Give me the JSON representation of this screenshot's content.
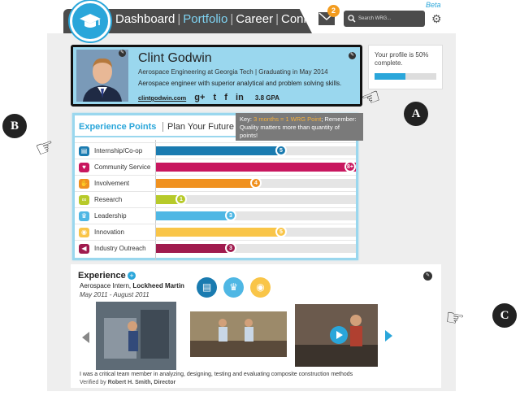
{
  "nav": {
    "items": [
      {
        "label": "Dashboard",
        "active": false
      },
      {
        "label": "Portfolio",
        "active": true
      },
      {
        "label": "Career",
        "active": false
      },
      {
        "label": "Connect",
        "active": false
      }
    ],
    "beta": "Beta",
    "mail_count": "2",
    "search_placeholder": "Search WRG...",
    "icons": [
      "graduation-cap-icon",
      "mail-icon",
      "search-icon",
      "gear-icon"
    ]
  },
  "profile": {
    "name": "Clint Godwin",
    "subtitle": "Aerospace Engineering at Georgia Tech | Graduating in May 2014",
    "description": "Aerospace engineer with superior analytical and problem solving skills.",
    "website": "clintgodwin.com",
    "social": [
      "g+",
      "t",
      "f",
      "in"
    ],
    "gpa": "3.8 GPA"
  },
  "completion": {
    "text": "Your profile is 50% complete.",
    "percent": 50
  },
  "points": {
    "tabs": [
      "Experience Points",
      "Plan Your Future"
    ],
    "key_prefix": "Key: ",
    "key_highlight": "3 months = 1 WRG Point",
    "key_rest": "; Remember: Quality matters more than quantity of points!",
    "max": 8,
    "rows": [
      {
        "label": "Internship/Co-op",
        "value": 5,
        "display": "5",
        "color": "#1a7bb0",
        "icon": "briefcase-icon"
      },
      {
        "label": "Community Service",
        "value": 8,
        "display": "8+",
        "color": "#c8175f",
        "icon": "heart-icon"
      },
      {
        "label": "Involvement",
        "value": 4,
        "display": "4",
        "color": "#f0911f",
        "icon": "hand-icon"
      },
      {
        "label": "Research",
        "value": 1,
        "display": "1",
        "color": "#b7ca2a",
        "icon": "infinity-icon"
      },
      {
        "label": "Leadership",
        "value": 3,
        "display": "3",
        "color": "#4fb7e4",
        "icon": "crown-icon"
      },
      {
        "label": "Innovation",
        "value": 5,
        "display": "5",
        "color": "#f9c548",
        "icon": "eye-icon"
      },
      {
        "label": "Industry Outreach",
        "value": 3,
        "display": "3",
        "color": "#a01b4e",
        "icon": "megaphone-icon"
      }
    ]
  },
  "callouts": {
    "a": "A",
    "b": "B",
    "c": "C"
  },
  "experience": {
    "title": "Experience",
    "role_prefix": "Aerospace Intern, ",
    "company": "Lockheed Martin",
    "dates": "May 2011 - August 2011",
    "description": "I was a critical team member in analyzing, designing, testing and evaluating composite construction methods",
    "verified_prefix": "Verified by ",
    "verified_by": "Robert H. Smith, Director",
    "category_icons": [
      {
        "icon": "briefcase-icon",
        "color": "#1a7bb0"
      },
      {
        "icon": "crown-icon",
        "color": "#4fb7e4"
      },
      {
        "icon": "eye-icon",
        "color": "#f9c548"
      }
    ]
  }
}
